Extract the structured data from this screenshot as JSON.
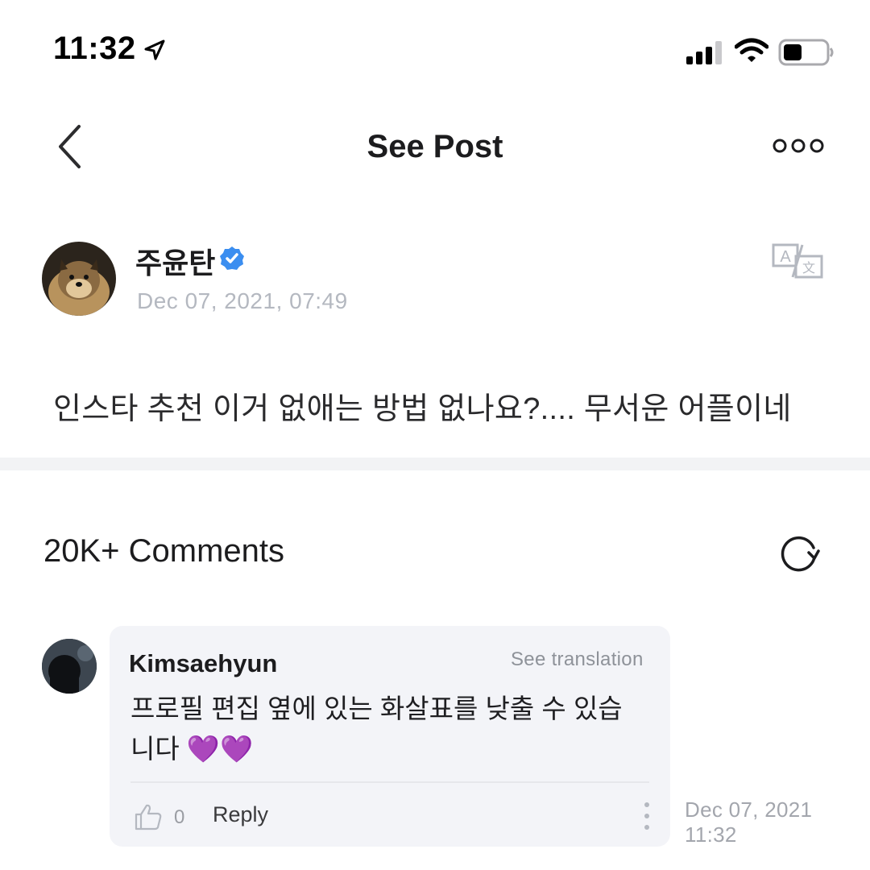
{
  "status_bar": {
    "time": "11:32"
  },
  "nav": {
    "title": "See Post"
  },
  "post": {
    "author": "주윤탄",
    "date": "Dec 07, 2021, 07:49",
    "body": "인스타 추천 이거 없애는 방법 없나요?.... 무서운 어플이네"
  },
  "comments": {
    "count_label": "20K+ Comments",
    "items": [
      {
        "author": "Kimsaehyun",
        "see_translation": "See translation",
        "text": "프로필 편집 옆에 있는 화살표를 낮출 수 있습니다 💜💜",
        "likes": "0",
        "reply_label": "Reply",
        "date": "Dec 07, 2021\n11:32"
      }
    ]
  },
  "colors": {
    "verified_blue": "#3b8ef0",
    "date_gray": "#b4b8c0",
    "bubble_bg": "#f3f4f8",
    "divider": "#f2f3f5"
  },
  "icons": [
    "location-arrow-icon",
    "signal-icon",
    "wifi-icon",
    "battery-icon",
    "back-chevron-icon",
    "more-icon",
    "verified-badge-icon",
    "translate-icon",
    "refresh-icon",
    "thumbs-up-icon",
    "kebab-menu-icon"
  ]
}
